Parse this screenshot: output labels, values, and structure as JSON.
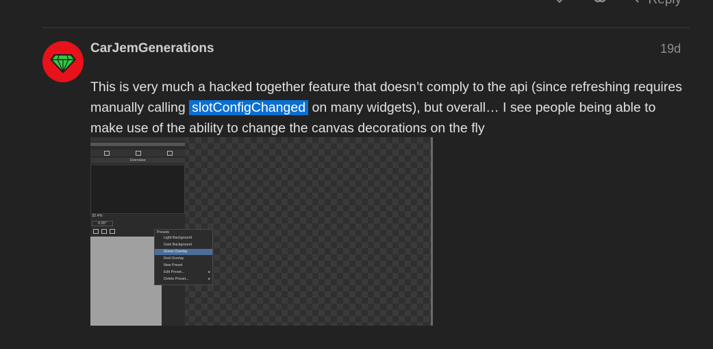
{
  "previous_post": {
    "reply_label": "Reply"
  },
  "post": {
    "username": "CarJemGenerations",
    "date": "19d",
    "body_before": "This is very much a hacked together feature that doesn’t comply to the api (since refreshing requires manually calling",
    "code_text": "slotConfigChanged",
    "body_after": "on many widgets), but overall… I see people being able to make use of the ability to change the canvas decorations on the fly"
  },
  "screenshot": {
    "overview_title": "Overview",
    "zoom_value": "32.4%",
    "rotation_value": "0.00°",
    "menu_title": "Presets",
    "menu_items": [
      {
        "label": "Light Background",
        "selected": false
      },
      {
        "label": "Dark Background",
        "selected": false
      },
      {
        "label": "Green Overlay",
        "selected": true
      },
      {
        "label": "Red Overlay",
        "selected": false
      },
      {
        "label": "New Preset",
        "selected": false
      },
      {
        "label": "Edit Preset...",
        "selected": false,
        "submenu": true
      },
      {
        "label": "Delete Preset...",
        "selected": false,
        "submenu": true
      }
    ]
  },
  "colors": {
    "background": "#222222",
    "avatar_bg": "#e8121a",
    "avatar_gem": "#2ecc40",
    "code_highlight": "#0b6fd1",
    "menu_selected": "#4b6f9a"
  },
  "icons": [
    "heart-icon",
    "link-icon",
    "reply-icon",
    "gem-icon"
  ]
}
